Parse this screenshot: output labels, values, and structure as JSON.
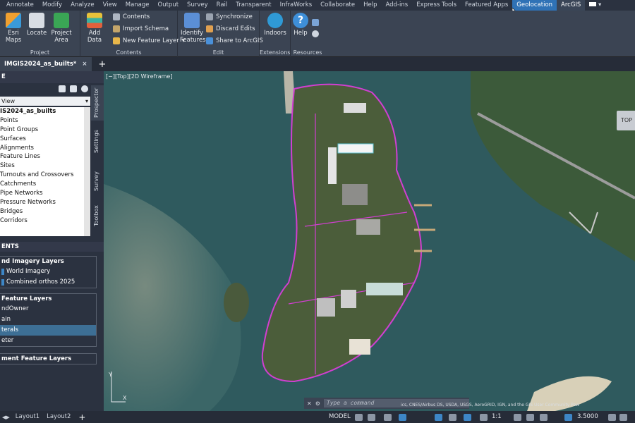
{
  "ribbon_tabs": [
    "Annotate",
    "Modify",
    "Analyze",
    "View",
    "Manage",
    "Output",
    "Survey",
    "Rail",
    "Transparent",
    "InfraWorks",
    "Collaborate",
    "Help",
    "Add-ins",
    "Express Tools",
    "Featured Apps",
    "Geolocation",
    "ArcGIS"
  ],
  "ribbon": {
    "project_group": {
      "label": "Project",
      "esri_maps": "Esri Maps",
      "locate": "Locate",
      "project_area": "Project Area"
    },
    "contents_group": {
      "label": "Contents",
      "add_data": "Add Data",
      "contents": "Contents",
      "import_schema": "Import Schema",
      "new_feature_layer": "New Feature Layer"
    },
    "edit_group": {
      "label": "Edit",
      "identify_features": "Identify Features",
      "synchronize": "Synchronize",
      "discard_edits": "Discard Edits",
      "share_to_arcgis": "Share to ArcGIS"
    },
    "extensions_group": {
      "label": "Extensions",
      "indoors": "Indoors"
    },
    "resources_group": {
      "label": "Resources",
      "help": "Help"
    }
  },
  "document_tab": "IMGIS2024_as_builts*",
  "palette": {
    "title": "E",
    "view_select": "View",
    "tree": [
      "IS2024_as_builts",
      "Points",
      "Point Groups",
      "Surfaces",
      "Alignments",
      "Feature Lines",
      "Sites",
      "Turnouts and Crossovers",
      "Catchments",
      "Pipe Networks",
      "Pressure Networks",
      "Bridges",
      "Corridors"
    ],
    "vertical_tabs": [
      "Prospector",
      "Settings",
      "Survey",
      "Toolbox"
    ]
  },
  "contents": {
    "header": "ENTS",
    "groups": [
      {
        "title": "nd Imagery Layers",
        "items": [
          "World Imagery",
          "Combined orthos 2025"
        ]
      },
      {
        "title": "Feature Layers",
        "items": [
          "ndOwner",
          "ain",
          "terals",
          "eter"
        ],
        "selected_index": 2
      },
      {
        "title": "ment Feature Layers",
        "items": []
      }
    ]
  },
  "viewport": {
    "label": "[−][Top][2D Wireframe]",
    "view_cube": "TOP",
    "command_placeholder": "Type a command",
    "attribution": "ics, CNES/Airbus DS, USDA, USGS, AeroGRID, IGN, and the GIS User Community  Pow"
  },
  "status_bar": {
    "layouts": [
      "Layout1",
      "Layout2"
    ],
    "model_label": "MODEL",
    "scale": "1:1",
    "lineweight": "3.5000"
  },
  "colors": {
    "accent": "#2f72b6",
    "ribbon": "#3b4453",
    "water": "#2f5a5e",
    "parcel": "#d13fd1"
  }
}
